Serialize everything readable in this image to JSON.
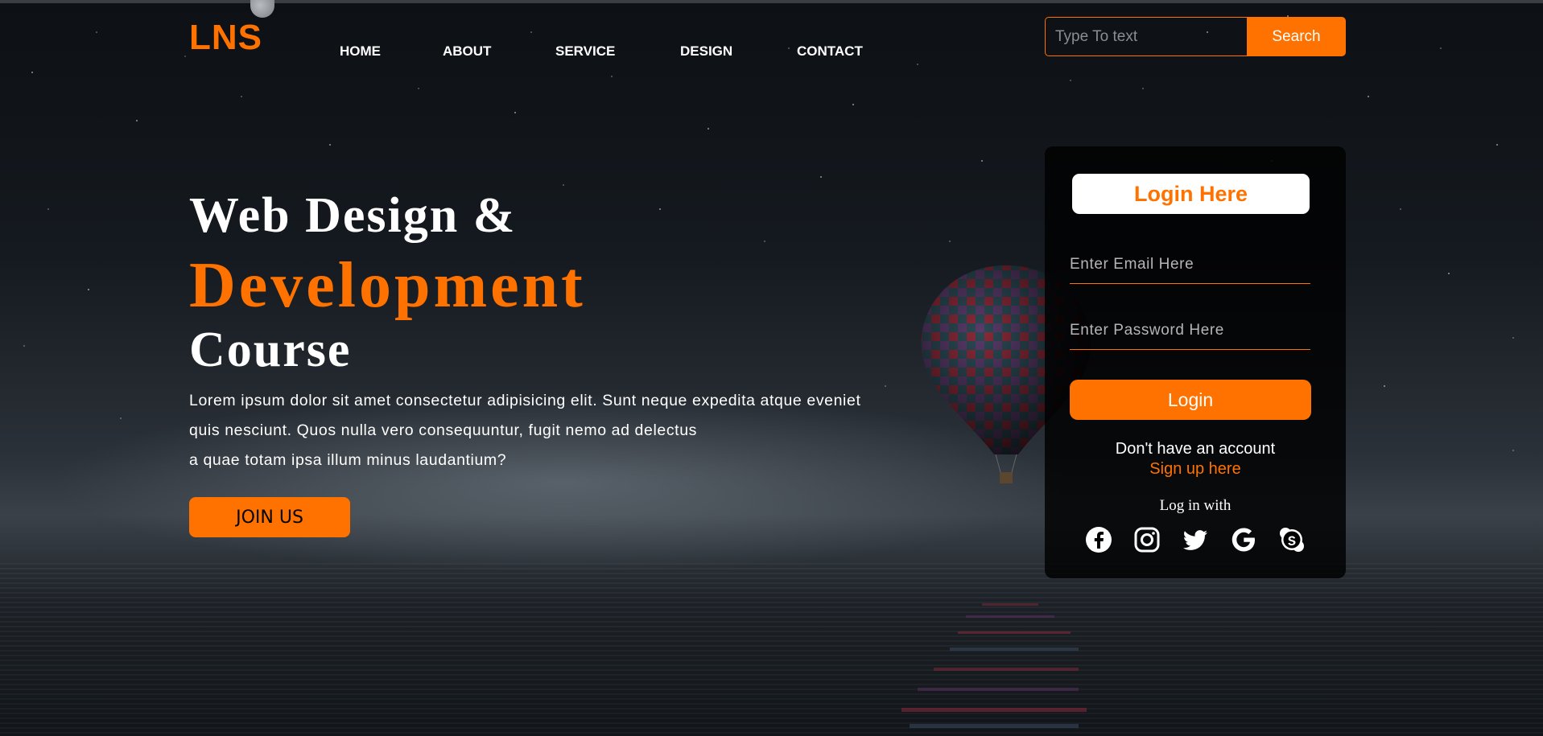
{
  "brand": {
    "logo": "LNS",
    "accent_color": "#ff7200"
  },
  "nav": {
    "items": [
      {
        "label": "HOME"
      },
      {
        "label": "ABOUT"
      },
      {
        "label": "SERVICE"
      },
      {
        "label": "DESIGN"
      },
      {
        "label": "CONTACT"
      }
    ]
  },
  "search": {
    "placeholder": "Type To text",
    "button_label": "Search"
  },
  "hero": {
    "line1": "Web Design &",
    "line2": "Development",
    "line3": "Course",
    "description": [
      "Lorem ipsum dolor sit amet consectetur adipisicing elit. Sunt neque expedita atque eveniet",
      "quis nesciunt. Quos nulla vero consequuntur, fugit nemo ad delectus",
      "a quae totam ipsa illum minus laudantium?"
    ],
    "cta_label": "JOIN US"
  },
  "login": {
    "title": "Login Here",
    "email_placeholder": "Enter Email Here",
    "password_placeholder": "Enter Password Here",
    "button_label": "Login",
    "no_account_text": "Don't have an account",
    "signup_link": "Sign up here",
    "login_with_text": "Log in with",
    "social_icons": [
      "facebook-icon",
      "instagram-icon",
      "twitter-icon",
      "google-icon",
      "skype-icon"
    ]
  }
}
